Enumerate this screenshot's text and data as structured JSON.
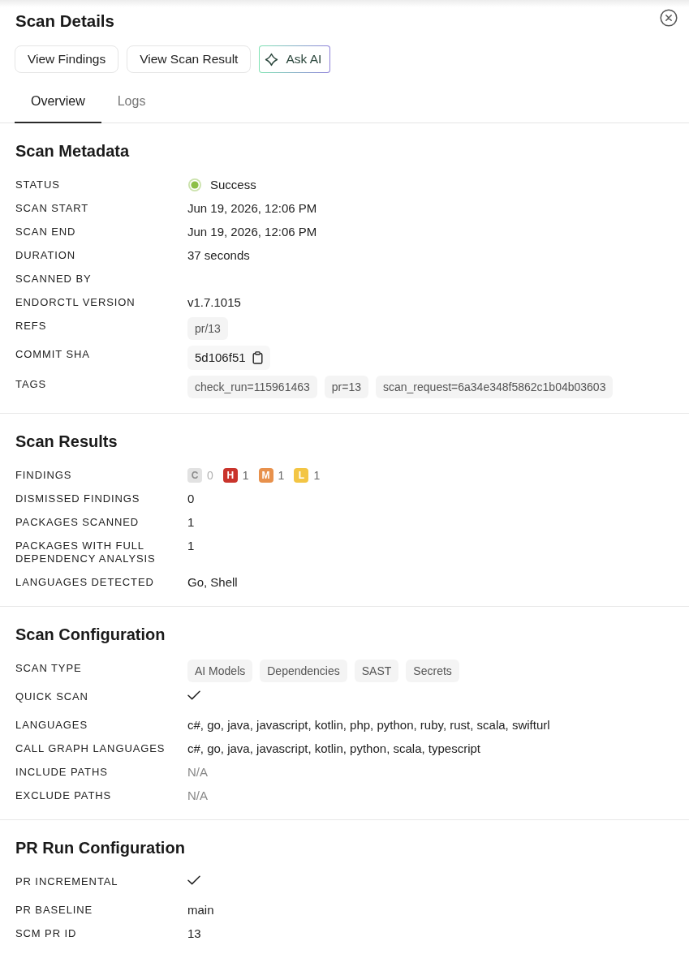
{
  "panel": {
    "title": "Scan Details"
  },
  "actions": [
    {
      "label": "View Findings",
      "kind": "plain"
    },
    {
      "label": "View Scan Result",
      "kind": "plain"
    },
    {
      "label": "Ask AI",
      "kind": "ai"
    }
  ],
  "tabs": [
    {
      "label": "Overview",
      "selected": true
    },
    {
      "label": "Logs",
      "selected": false
    }
  ],
  "sections": [
    {
      "title": "Scan Metadata",
      "rows": [
        {
          "label": "STATUS",
          "kind": "status",
          "value": "Success",
          "color": "#8cbf47"
        },
        {
          "label": "SCAN START",
          "kind": "text",
          "value": "Jun 19, 2026, 12:06 PM"
        },
        {
          "label": "SCAN END",
          "kind": "text",
          "value": "Jun 19, 2026, 12:06 PM"
        },
        {
          "label": "DURATION",
          "kind": "text",
          "value": "37 seconds"
        },
        {
          "label": "SCANNED BY",
          "kind": "text"
        },
        {
          "label": "ENDORCTL VERSION",
          "kind": "text",
          "value": "v1.7.1015"
        },
        {
          "label": "REFS",
          "kind": "chips",
          "chips": [
            "pr/13"
          ]
        },
        {
          "label": "COMMIT SHA",
          "kind": "copy",
          "value": "5d106f51"
        },
        {
          "label": "TAGS",
          "kind": "chips",
          "chips": [
            "check_run=115961463",
            "pr=13",
            "scan_request=6a34e348f5862c1b04b03603"
          ]
        }
      ]
    },
    {
      "title": "Scan Results",
      "rows": [
        {
          "label": "FINDINGS",
          "kind": "severity",
          "counts": [
            {
              "letter": "C",
              "count": "0",
              "color": "#e2e2e2",
              "disabled": true
            },
            {
              "letter": "H",
              "count": "1",
              "color": "#c9342c",
              "disabled": false
            },
            {
              "letter": "M",
              "count": "1",
              "color": "#e8914c",
              "disabled": false
            },
            {
              "letter": "L",
              "count": "1",
              "color": "#f3c544",
              "disabled": false
            }
          ]
        },
        {
          "label": "DISMISSED FINDINGS",
          "kind": "text",
          "value": "0"
        },
        {
          "label": "PACKAGES SCANNED",
          "kind": "text",
          "value": "1"
        },
        {
          "label": "PACKAGES WITH FULL DEPENDENCY ANALYSIS",
          "kind": "text",
          "value": "1"
        },
        {
          "label": "LANGUAGES DETECTED",
          "kind": "text",
          "value": "Go, Shell"
        }
      ]
    },
    {
      "title": "Scan Configuration",
      "rows": [
        {
          "label": "SCAN TYPE",
          "kind": "chips",
          "chips": [
            "AI Models",
            "Dependencies",
            "SAST",
            "Secrets"
          ]
        },
        {
          "label": "QUICK SCAN",
          "kind": "check",
          "checked": true
        },
        {
          "label": "LANGUAGES",
          "kind": "text",
          "value": "c#, go, java, javascript, kotlin, php, python, ruby, rust, scala, swifturl"
        },
        {
          "label": "CALL GRAPH LANGUAGES",
          "kind": "text",
          "value": "c#, go, java, javascript, kotlin, python, scala, typescript"
        },
        {
          "label": "INCLUDE PATHS",
          "kind": "muted",
          "value": "N/A"
        },
        {
          "label": "EXCLUDE PATHS",
          "kind": "muted",
          "value": "N/A"
        }
      ]
    },
    {
      "title": "PR Run Configuration",
      "rows": [
        {
          "label": "PR INCREMENTAL",
          "kind": "check",
          "checked": true
        },
        {
          "label": "PR BASELINE",
          "kind": "text",
          "value": "main"
        },
        {
          "label": "SCM PR ID",
          "kind": "text",
          "value": "13"
        }
      ]
    }
  ]
}
